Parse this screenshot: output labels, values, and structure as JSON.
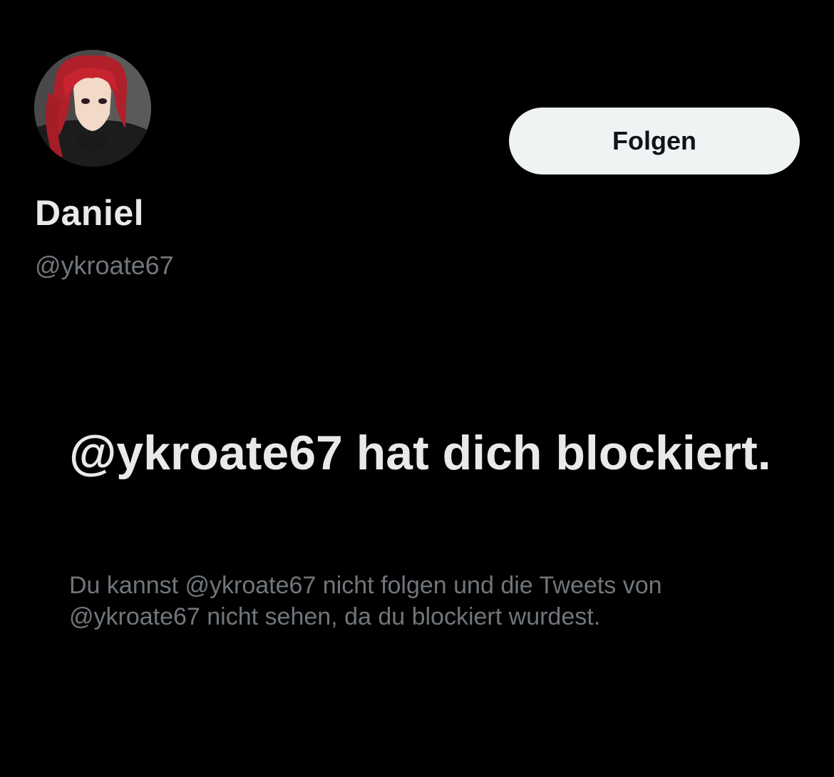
{
  "profile": {
    "display_name": "Daniel",
    "handle": "@ykroate67",
    "avatar_icon": "anime-avatar-red-hair"
  },
  "actions": {
    "follow_label": "Folgen"
  },
  "blocked_notice": {
    "title": "@ykroate67 hat dich blockiert.",
    "description": "Du kannst @ykroate67 nicht folgen und die Tweets von @ykroate67 nicht sehen, da du blockiert wurdest."
  },
  "colors": {
    "background": "#000000",
    "primary_text": "#e7e9ea",
    "secondary_text": "#71767b",
    "button_bg": "#eff3f4",
    "button_text": "#0f1419"
  }
}
